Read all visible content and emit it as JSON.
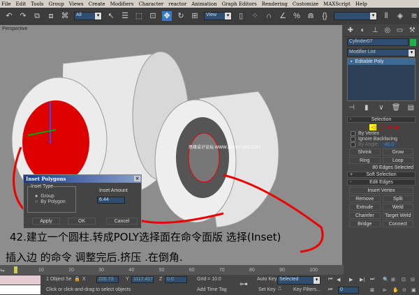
{
  "menu": [
    "File",
    "Edit",
    "Tools",
    "Group",
    "Views",
    "Create",
    "Modifiers",
    "Character",
    "reactor",
    "Animation",
    "Graph Editors",
    "Rendering",
    "Customize",
    "MAXScript",
    "Help"
  ],
  "toolbar": {
    "filter": "All",
    "coord": "View",
    "named_sel": ""
  },
  "viewport": {
    "label": "Perspective",
    "watermark": "思缘设计论坛 WWW.MISSYUAN.COM"
  },
  "panel": {
    "object_name": "Cylinder07",
    "object_color": "#1fb04a",
    "modifier_list": "Modifier List",
    "stack_item": "Editable Poly",
    "selection": {
      "title": "Selection",
      "by_vertex": "By Vertex",
      "ignore_backfacing": "Ignore Backfacing",
      "by_angle": "By Angle:",
      "angle": "45.0",
      "shrink": "Shrink",
      "grow": "Grow",
      "ring": "Ring",
      "loop": "Loop",
      "status": "80 Edges Selected"
    },
    "soft_selection": "Soft Selection",
    "edit_edges": {
      "title": "Edit Edges",
      "insert_vertex": "Insert Vertex",
      "remove": "Remove",
      "split": "Split",
      "extrude": "Extrude",
      "weld": "Weld",
      "chamfer": "Chamfer",
      "target_weld": "Target Weld",
      "bridge": "Bridge",
      "connect": "Connect"
    }
  },
  "dialog": {
    "title": "Inset Polygons",
    "inset_type": "Inset Type",
    "group": "Group",
    "by_polygon": "By Polygon",
    "amount_label": "Inset Amount",
    "amount": "6.44",
    "apply": "Apply",
    "ok": "OK",
    "cancel": "Cancel"
  },
  "caption": {
    "line1": "42.建立一个圆柱.转成POLY选择面在命令面版 选择(Inset)",
    "line2": "插入边 的命令 调整完后.挤压 .在倒角."
  },
  "timeline": {
    "ticks": [
      "10",
      "20",
      "30",
      "40",
      "50",
      "60",
      "70",
      "80",
      "90",
      "100"
    ]
  },
  "status": {
    "objects": "1 Object Se",
    "x": "220.73",
    "y": "1117.417",
    "z": "0.0",
    "grid": "Grid = 10.0",
    "add_time_tag": "Add Time Tag",
    "prompt": "Click or click-and-drag to select objects",
    "auto_key": "Auto Key",
    "set_key": "Set Key",
    "key_mode": "Selected",
    "key_filters": "Key Filters...",
    "frame": "0"
  }
}
